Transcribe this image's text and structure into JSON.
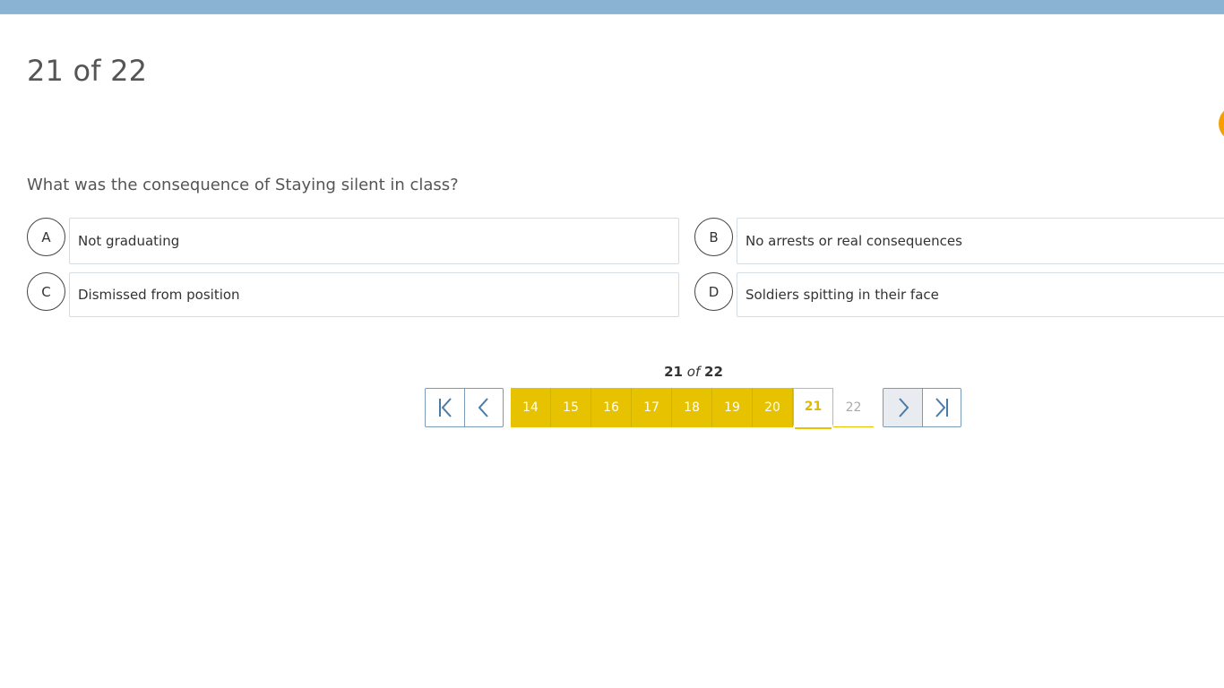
{
  "header": {
    "counter": "21 of 22"
  },
  "question": {
    "text": "What was the consequence of Staying silent in class?"
  },
  "options": [
    {
      "letter": "A",
      "text": "Not graduating"
    },
    {
      "letter": "B",
      "text": "No arrests or real consequences"
    },
    {
      "letter": "C",
      "text": "Dismissed from position"
    },
    {
      "letter": "D",
      "text": "Soldiers spitting in their face"
    }
  ],
  "pager": {
    "current": "21",
    "of_word": "of",
    "total": "22",
    "pages": [
      "14",
      "15",
      "16",
      "17",
      "18",
      "19",
      "20",
      "21",
      "22"
    ],
    "icons": {
      "first": "first-page-icon",
      "prev": "chevron-left-icon",
      "next": "chevron-right-icon",
      "last": "last-page-icon"
    }
  },
  "colors": {
    "accent": "#e6c200",
    "nav_border": "#7a9bb8",
    "top_bar": "#8ab2d3",
    "orange": "#f5a000"
  }
}
